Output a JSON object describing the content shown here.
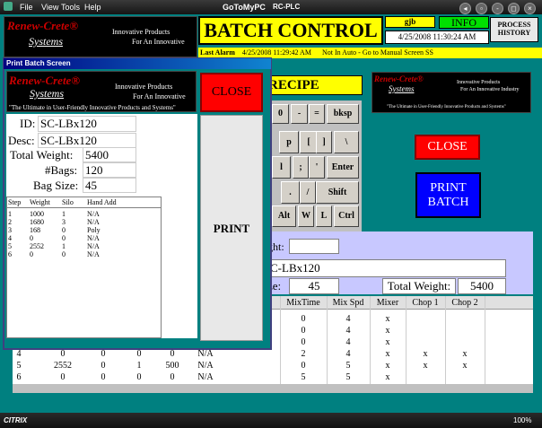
{
  "menu": [
    "File",
    "View",
    "Tools",
    "Help"
  ],
  "app": {
    "brand": "GoToMyPC",
    "host": "RC-PLC"
  },
  "header": {
    "title": "BATCH CONTROL",
    "user": "gjb",
    "info": "INFO",
    "process_history": "PROCESS HISTORY",
    "datetime": "4/25/2008  11:30:24 AM"
  },
  "alarm": {
    "label": "Last Alarm",
    "time": "4/25/2008  11:29:42 AM",
    "msg": "Not In Auto - Go to Manual Screen SS"
  },
  "logo": {
    "name": "Renew-Crete®",
    "sub": "Systems",
    "tag1": "Innovative Products",
    "tag2": "For An Innovative",
    "tag2b": "For An Innovative Industry",
    "tag3": "\"The Ultimate in User-Friendly Innovative Products and Systems\""
  },
  "recipe_title": "RECIPE",
  "keys": [
    "0",
    "-",
    "=",
    "bksp",
    "p",
    "[",
    "]",
    "\\",
    "l",
    ";",
    "'",
    "Enter",
    ".",
    "/",
    "Shift",
    "Alt",
    "W",
    "L",
    "Ctrl"
  ],
  "right": {
    "close": "CLOSE",
    "print_batch": "PRINT BATCH"
  },
  "main": {
    "weight_label": "ght:",
    "recipe_id": "C-LBx120",
    "size_label": "ze:",
    "size": "45",
    "total_label": "Total Weight:",
    "total": "5400"
  },
  "table": {
    "headers": [
      "MixTime",
      "Mix Spd",
      "Mixer",
      "Chop 1",
      "Chop 2"
    ],
    "rows_right": [
      [
        "0",
        "4",
        "x",
        "",
        ""
      ],
      [
        "0",
        "4",
        "x",
        "",
        ""
      ],
      [
        "0",
        "4",
        "x",
        "",
        ""
      ],
      [
        "2",
        "4",
        "x",
        "x",
        "x"
      ],
      [
        "0",
        "5",
        "x",
        "x",
        "x"
      ],
      [
        "5",
        "5",
        "x",
        "",
        ""
      ]
    ],
    "rows_left": [
      [
        "4",
        "0",
        "0",
        "0",
        "0",
        "N/A"
      ],
      [
        "5",
        "2552",
        "0",
        "1",
        "500",
        "N/A"
      ],
      [
        "6",
        "0",
        "0",
        "0",
        "0",
        "N/A"
      ]
    ]
  },
  "dialog": {
    "title": "Print Batch Screen",
    "close": "CLOSE",
    "print": "PRINT",
    "scrolltext": "\"The Ultimate in User-Friendly Innovative Products and Systems\"",
    "fields": [
      {
        "label": "ID:",
        "value": "SC-LBx120"
      },
      {
        "label": "Desc:",
        "value": "SC-LBx120"
      },
      {
        "label": "Total Weight:",
        "value": "5400"
      },
      {
        "label": "#Bags:",
        "value": "120"
      },
      {
        "label": "Bag Size:",
        "value": "45"
      }
    ],
    "headers": [
      "Step",
      "Weight",
      "Silo",
      "Hand Add"
    ],
    "rows": [
      [
        "1",
        "1000",
        "1",
        "N/A"
      ],
      [
        "2",
        "1680",
        "3",
        "N/A"
      ],
      [
        "3",
        "168",
        "0",
        "Poly"
      ],
      [
        "4",
        "0",
        "0",
        "N/A"
      ],
      [
        "5",
        "2552",
        "1",
        "N/A"
      ],
      [
        "6",
        "0",
        "0",
        "N/A"
      ]
    ]
  },
  "status": {
    "citrix": "CITRIX",
    "zoom": "100%"
  }
}
